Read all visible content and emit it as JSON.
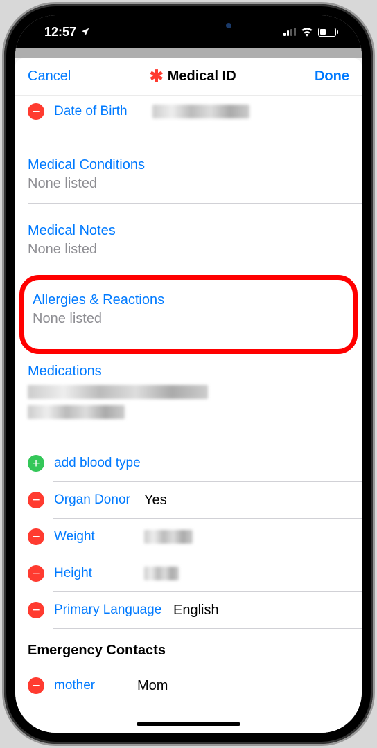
{
  "statusBar": {
    "time": "12:57"
  },
  "nav": {
    "cancel": "Cancel",
    "title": "Medical ID",
    "done": "Done"
  },
  "fields": {
    "dob": {
      "label": "Date of Birth"
    },
    "conditions": {
      "title": "Medical Conditions",
      "value": "None listed"
    },
    "notes": {
      "title": "Medical Notes",
      "value": "None listed"
    },
    "allergies": {
      "title": "Allergies & Reactions",
      "value": "None listed"
    },
    "medications": {
      "title": "Medications"
    },
    "addBloodType": {
      "label": "add blood type"
    },
    "organDonor": {
      "label": "Organ Donor",
      "value": "Yes"
    },
    "weight": {
      "label": "Weight"
    },
    "height": {
      "label": "Height"
    },
    "primaryLanguage": {
      "label": "Primary Language",
      "value": "English"
    }
  },
  "emergencyContacts": {
    "header": "Emergency Contacts",
    "items": [
      {
        "relation": "mother",
        "name": "Mom"
      }
    ]
  }
}
